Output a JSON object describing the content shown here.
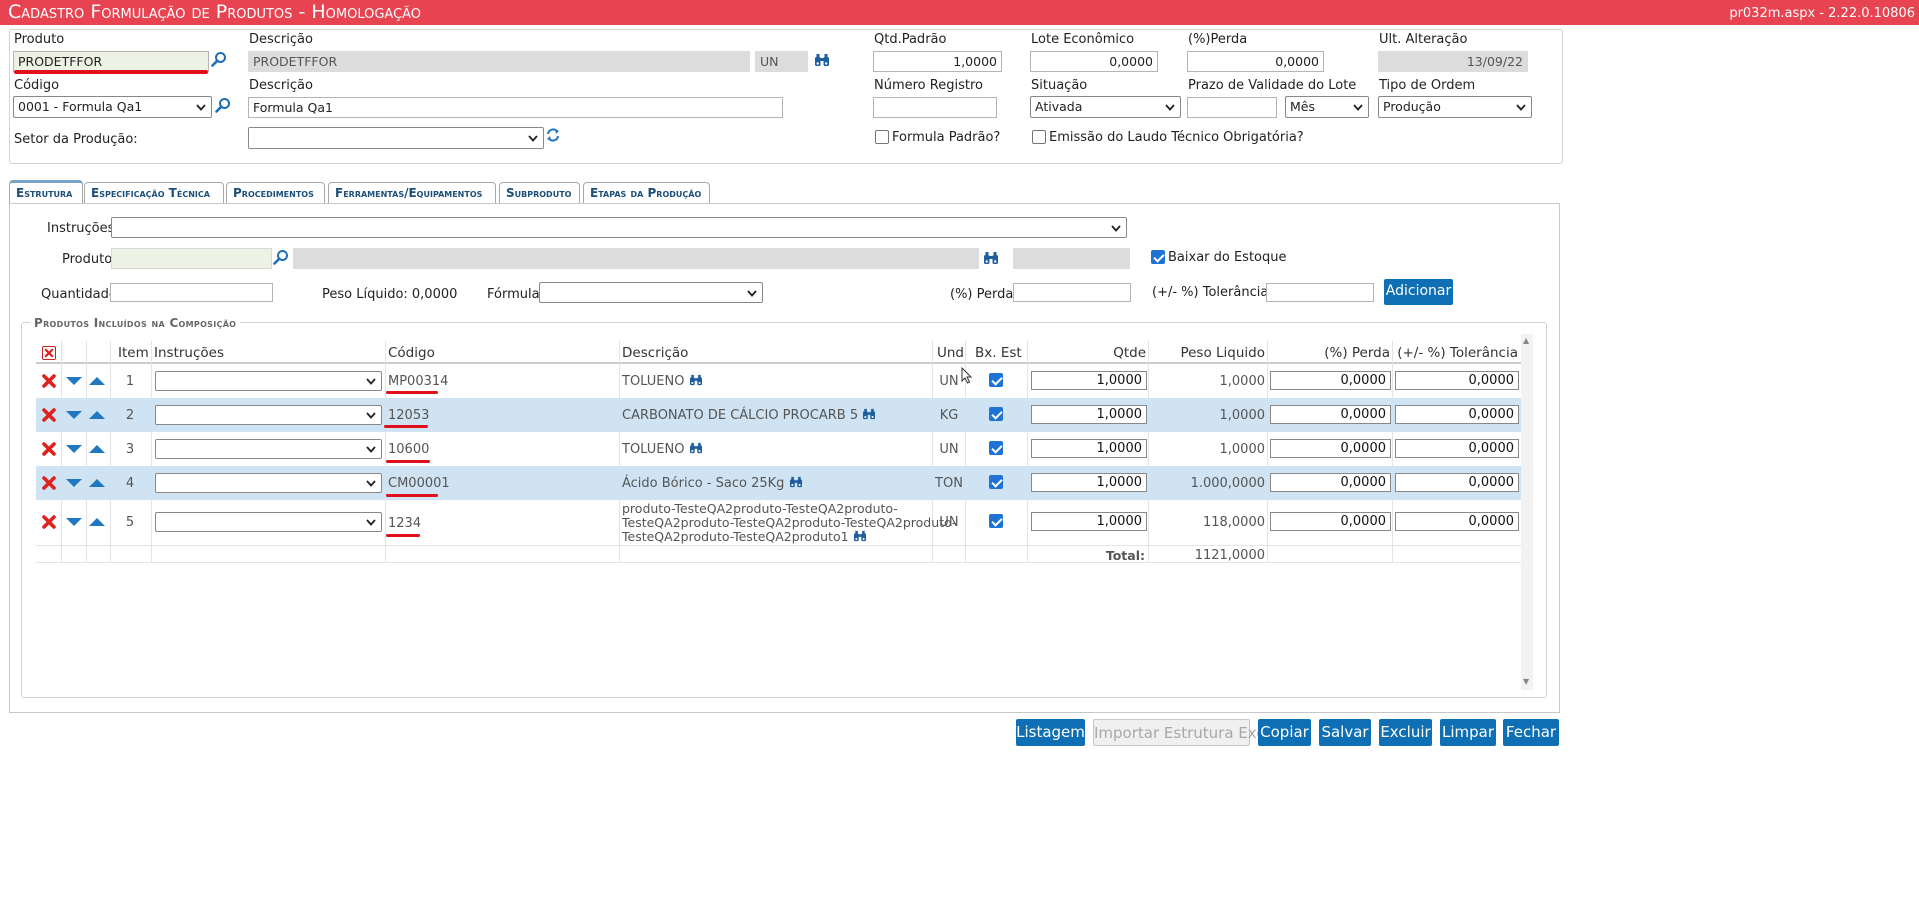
{
  "header": {
    "title": "Cadastro Formulação de Produtos  - Homologação",
    "version": "pr032m.aspx - 2.22.0.10806"
  },
  "form": {
    "produto": {
      "label": "Produto",
      "value": "PRODETFFOR"
    },
    "descricao1": {
      "label": "Descrição",
      "value": "PRODETFFOR",
      "unit": "UN"
    },
    "qtd_padrao": {
      "label": "Qtd.Padrão",
      "value": "1,0000"
    },
    "lote_economico": {
      "label": "Lote Econômico",
      "value": "0,0000"
    },
    "perda": {
      "label": "(%)Perda",
      "value": "0,0000"
    },
    "ult_alteracao": {
      "label": "Ult. Alteração",
      "value": "13/09/22"
    },
    "codigo": {
      "label": "Código",
      "value": "0001 - Formula Qa1"
    },
    "descricao2": {
      "label": "Descrição",
      "value": "Formula Qa1"
    },
    "numero_registro": {
      "label": "Número Registro",
      "value": ""
    },
    "situacao": {
      "label": "Situação",
      "value": "Ativada"
    },
    "prazo_validade": {
      "label": "Prazo de Validade do Lote",
      "value": "",
      "unit": "Mês"
    },
    "tipo_ordem": {
      "label": "Tipo de Ordem",
      "value": "Produção"
    },
    "setor_producao": {
      "label": "Setor da Produção:",
      "value": ""
    },
    "formula_padrao": {
      "label": "Formula Padrão?",
      "checked": false
    },
    "emissao_laudo": {
      "label": "Emissão do Laudo Técnico Obrigatória?",
      "checked": false
    }
  },
  "tabs": [
    "Estrutura",
    "Especificação Técnica",
    "Procedimentos",
    "Ferramentas/Equipamentos",
    "Subproduto",
    "Etapas da Produção"
  ],
  "estrutura": {
    "instrucoes_label": "Instruções:",
    "produto_label": "Produto:",
    "baixar_estoque_label": "Baixar do Estoque",
    "baixar_estoque": true,
    "quantidade_label": "Quantidade:",
    "peso_liquido_text": "Peso Líquido: 0,0000",
    "formula_label": "Fórmula:",
    "perda_label": "(%) Perda:",
    "tolerancia_label": "(+/- %) Tolerância:",
    "adicionar": "Adicionar",
    "group_title": "Produtos Incluídos na Composição"
  },
  "table": {
    "columns": [
      "Item",
      "Instruções",
      "Código",
      "Descrição",
      "Und",
      "Bx. Est",
      "Qtde",
      "Peso Liquido",
      "(%) Perda",
      "(+/- %) Tolerância"
    ],
    "rows": [
      {
        "item": "1",
        "codigo": "MP00314",
        "descricao": "TOLUENO",
        "und": "UN",
        "bx": true,
        "qtde": "1,0000",
        "peso": "1,0000",
        "perda": "0,0000",
        "tol": "0,0000"
      },
      {
        "item": "2",
        "codigo": "12053",
        "descricao": "CARBONATO DE CÁLCIO PROCARB 5",
        "und": "KG",
        "bx": true,
        "qtde": "1,0000",
        "peso": "1,0000",
        "perda": "0,0000",
        "tol": "0,0000"
      },
      {
        "item": "3",
        "codigo": "10600",
        "descricao": "TOLUENO",
        "und": "UN",
        "bx": true,
        "qtde": "1,0000",
        "peso": "1,0000",
        "perda": "0,0000",
        "tol": "0,0000"
      },
      {
        "item": "4",
        "codigo": "CM00001",
        "descricao": "Ácido Bórico - Saco 25Kg",
        "und": "TON",
        "bx": true,
        "qtde": "1,0000",
        "peso": "1.000,0000",
        "perda": "0,0000",
        "tol": "0,0000"
      },
      {
        "item": "5",
        "codigo": "1234",
        "descricao": "produto-TesteQA2produto-TesteQA2produto-TesteQA2produto-TesteQA2produto-TesteQA2produto-TesteQA2produto-TesteQA2produto1",
        "descricao_lines": [
          "produto-TesteQA2produto-TesteQA2produto-",
          "TesteQA2produto-TesteQA2produto-TesteQA2produto-",
          "TesteQA2produto-TesteQA2produto1"
        ],
        "und": "UN",
        "bx": true,
        "qtde": "1,0000",
        "peso": "118,0000",
        "perda": "0,0000",
        "tol": "0,0000"
      }
    ],
    "total_label": "Total:",
    "total_value": "1121,0000"
  },
  "buttons": {
    "listagem": "Listagem",
    "importar": "Importar Estrutura Excel",
    "copiar": "Copiar",
    "salvar": "Salvar",
    "excluir": "Excluir",
    "limpar": "Limpar",
    "fechar": "Fechar"
  },
  "colors": {
    "title_bg": "#e84350",
    "accent": "#0f6fb5",
    "row_alt": "#cfe3f3"
  }
}
